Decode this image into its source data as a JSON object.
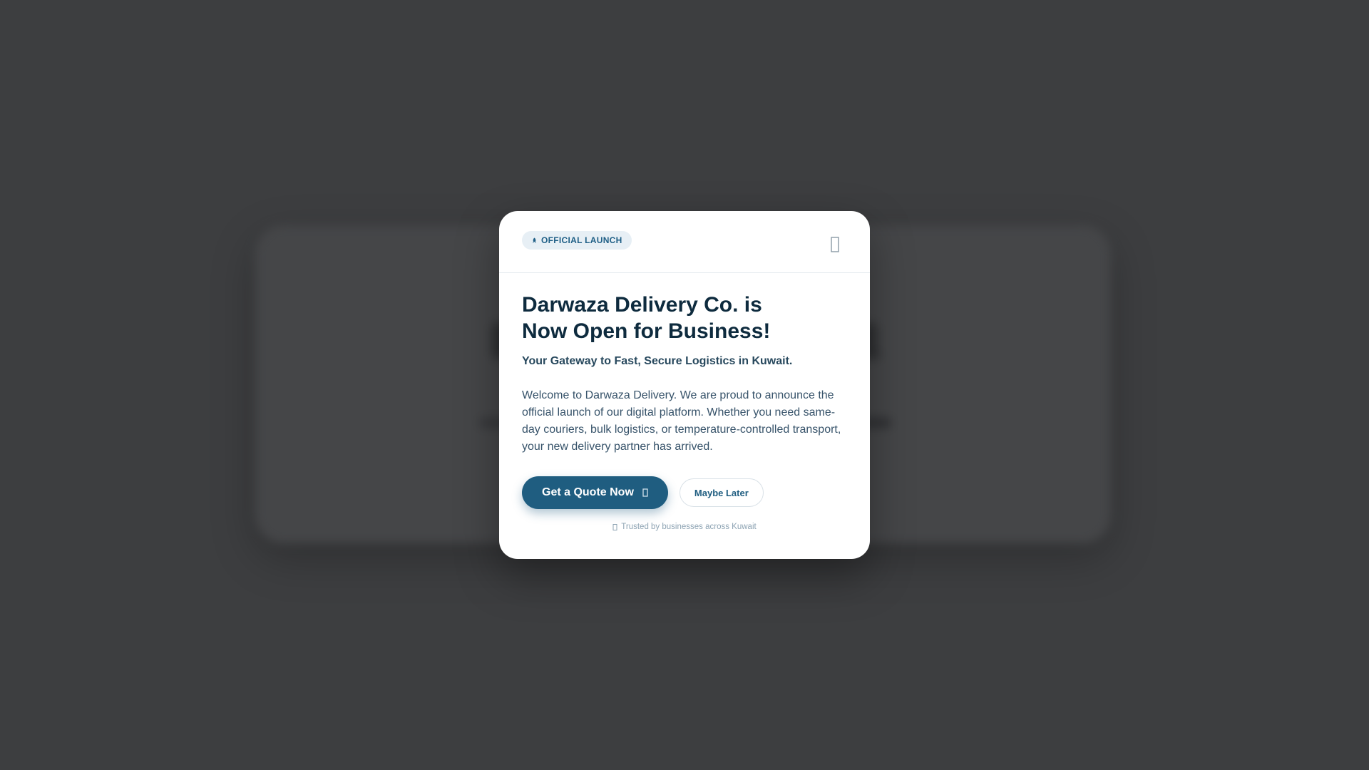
{
  "modal": {
    "badge_label": "OFFICIAL LAUNCH",
    "title_line1": "Darwaza Delivery Co. is",
    "title_line2": "Now Open for Business!",
    "tagline": "Your Gateway to Fast, Secure Logistics in Kuwait.",
    "description": "Welcome to Darwaza Delivery. We are proud to announce the official launch of our digital platform. Whether you need same-day couriers, bulk logistics, or temperature-controlled transport, your new delivery partner has arrived.",
    "primary_button_label": "Get a Quote Now",
    "secondary_button_label": "Maybe Later",
    "trust_text": "Trusted by businesses across Kuwait",
    "icons": {
      "badge": "rocket-icon",
      "close": "close-icon",
      "primary_button": "arrow-right-icon",
      "trust": "shield-icon"
    }
  },
  "colors": {
    "overlay": "#3d3e40",
    "primary": "#1f5d80",
    "title": "#0e2b3e",
    "badge_bg": "#e7eff5"
  }
}
